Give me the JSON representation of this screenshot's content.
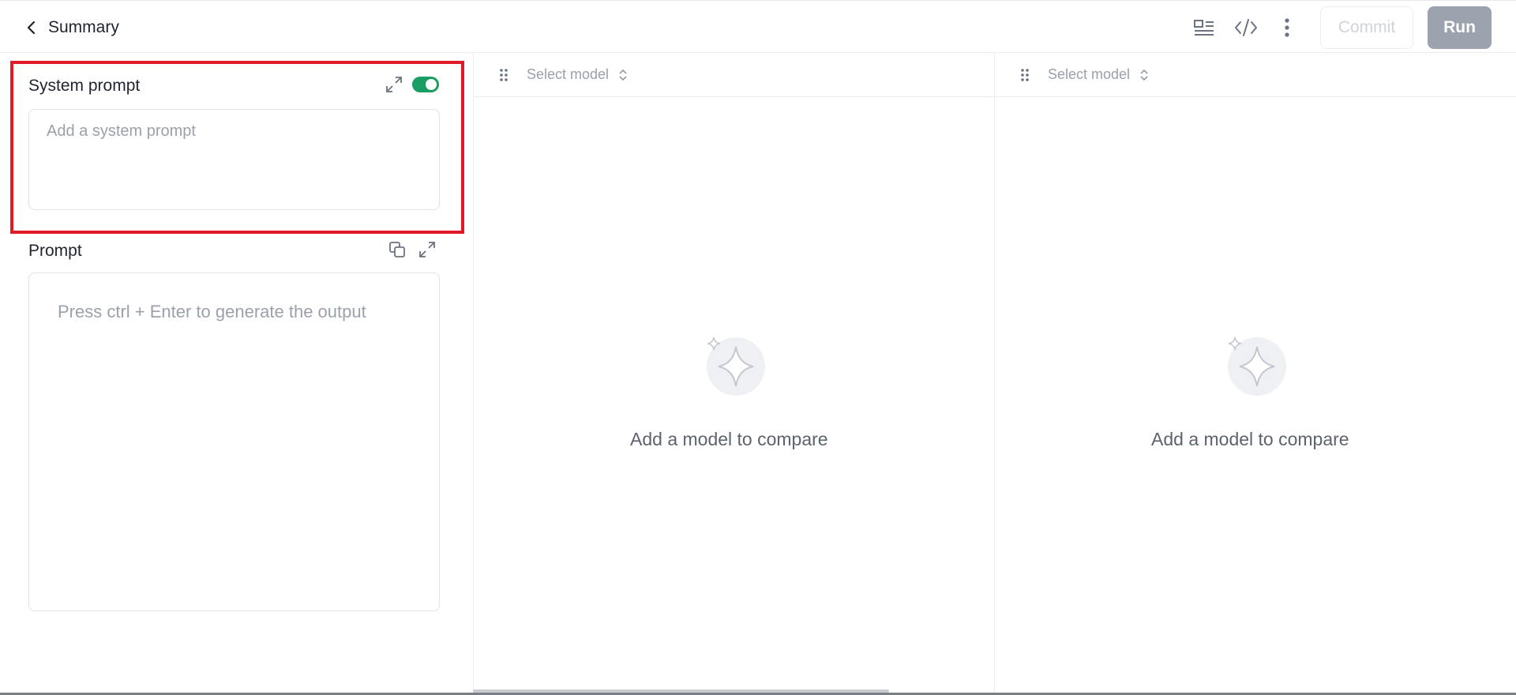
{
  "header": {
    "title": "Summary",
    "icons": [
      "back-chevron-icon",
      "layout-icon",
      "code-icon",
      "more-vertical-icon"
    ],
    "commit_label": "Commit",
    "run_label": "Run"
  },
  "system_prompt": {
    "label": "System prompt",
    "placeholder": "Add a system prompt",
    "enabled": true
  },
  "prompt": {
    "label": "Prompt",
    "placeholder": "Press ctrl + Enter to generate the output"
  },
  "compare": {
    "columns": [
      {
        "select_label": "Select model",
        "empty_text": "Add a model to compare"
      },
      {
        "select_label": "Select model",
        "empty_text": "Add a model to compare"
      }
    ]
  },
  "colors": {
    "toggle_on": "#1a9e63",
    "highlight_border": "#e01b26",
    "run_button": "#9aa3ae"
  }
}
